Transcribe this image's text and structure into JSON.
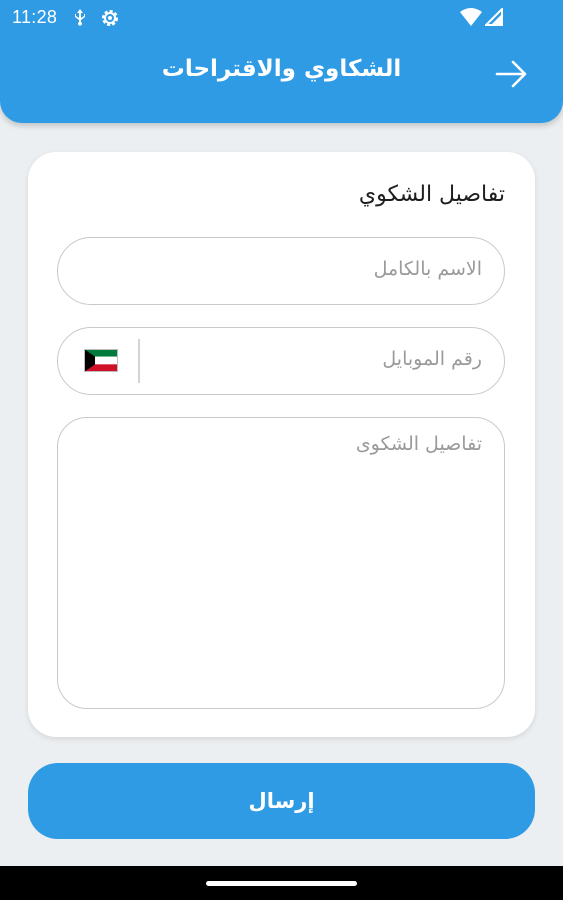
{
  "status_bar": {
    "time": "11:28",
    "icons": [
      "usb-icon",
      "settings-gear-icon",
      "wifi-icon",
      "signal-icon"
    ]
  },
  "header": {
    "title": "الشكاوي والاقتراحات",
    "back_icon": "arrow-right-icon",
    "color": "#2f9be5"
  },
  "form": {
    "title": "تفاصيل الشكوي",
    "name_placeholder": "الاسم بالكامل",
    "phone_placeholder": "رقم الموبايل",
    "details_placeholder": "تفاصيل الشكوى",
    "country_flag": "kuwait-flag-icon"
  },
  "submit_label": "إرسال"
}
